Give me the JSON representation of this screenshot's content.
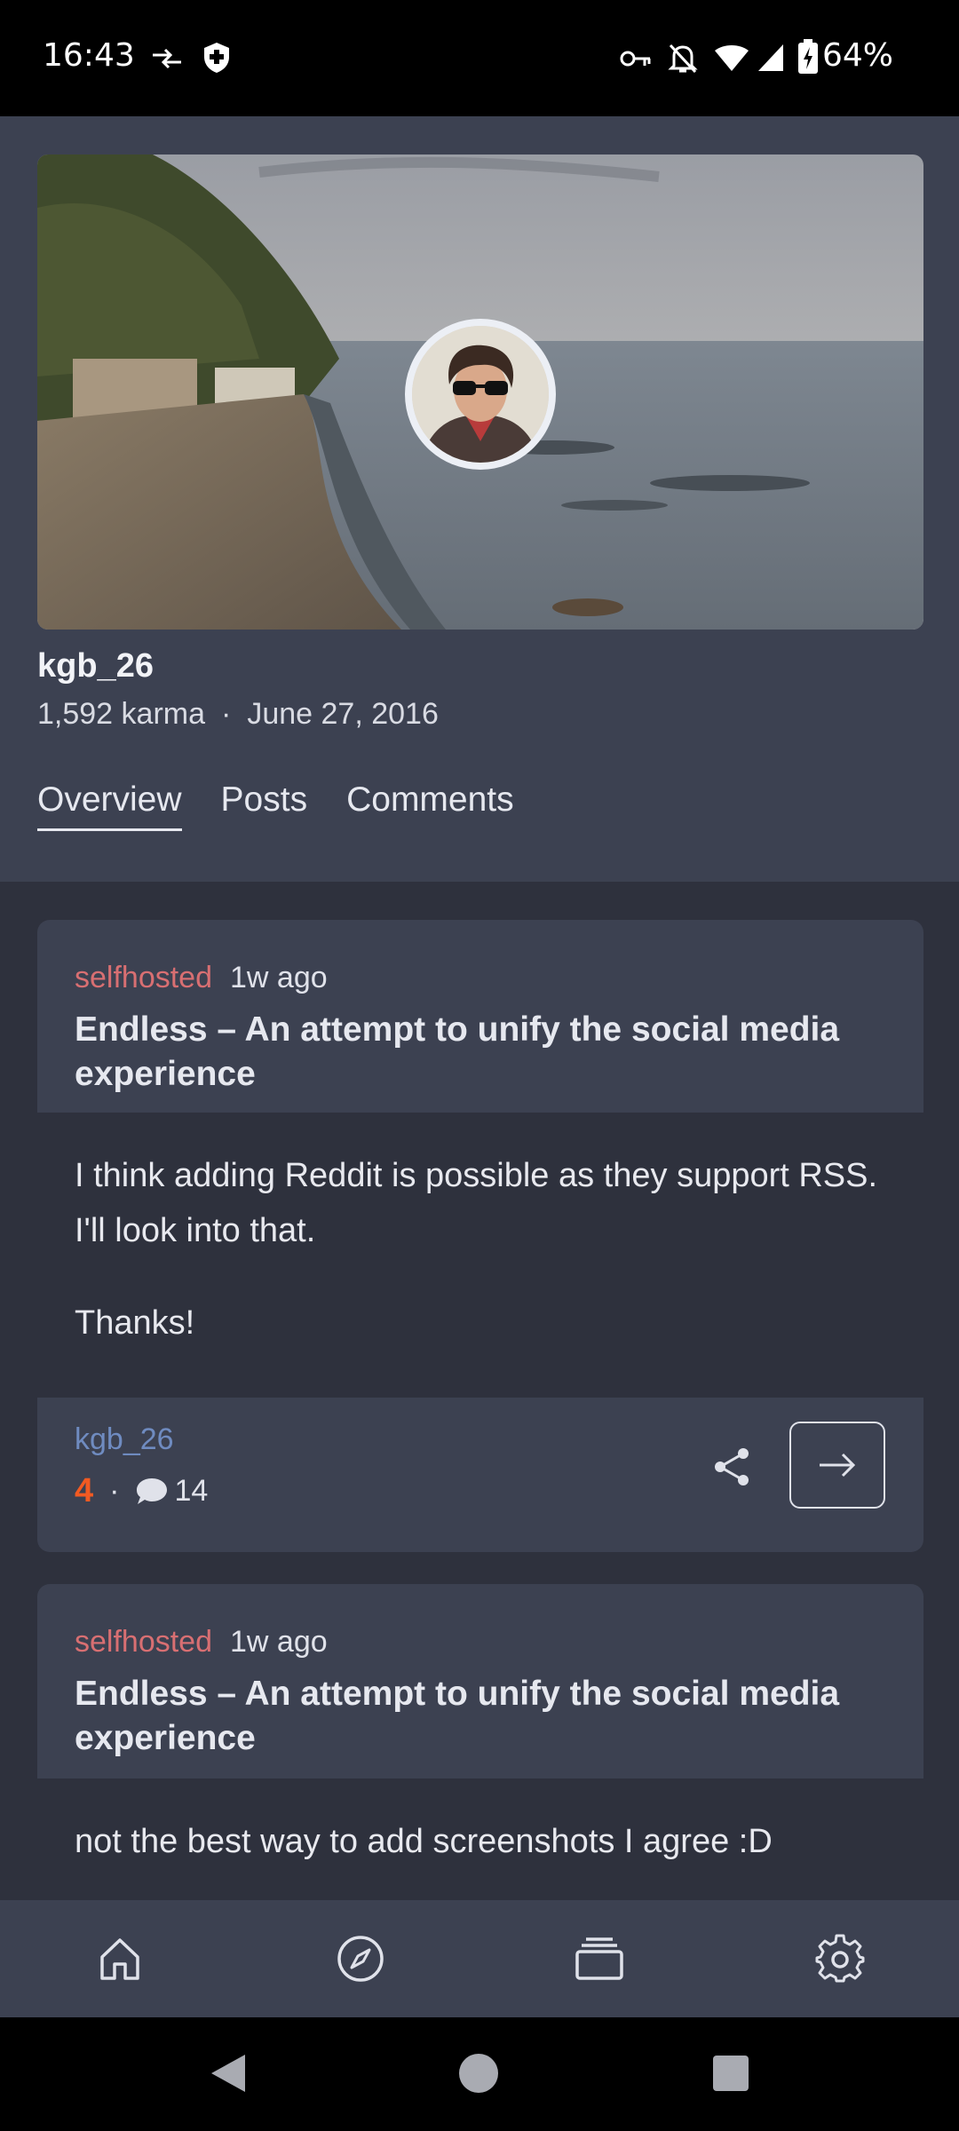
{
  "status_bar": {
    "time": "16:43",
    "battery": "64%",
    "icons": [
      "data-transfer-icon",
      "shield-icon",
      "vpn-key-icon",
      "bell-off-icon",
      "wifi-icon",
      "signal-icon",
      "battery-charging-icon"
    ]
  },
  "profile": {
    "username": "kgb_26",
    "karma": "1,592 karma",
    "separator": "·",
    "joined": "June 27, 2016",
    "tabs": [
      {
        "label": "Overview",
        "active": true
      },
      {
        "label": "Posts",
        "active": false
      },
      {
        "label": "Comments",
        "active": false
      }
    ]
  },
  "comments": [
    {
      "subreddit": "selfhosted",
      "age": "1w ago",
      "post_title": "Endless – An attempt to unify the social media experience",
      "body": [
        "I think adding Reddit is possible as they support RSS. I'll look into that.",
        "Thanks!"
      ],
      "author": "kgb_26",
      "score": "4",
      "separator": "·",
      "comment_count": "14"
    },
    {
      "subreddit": "selfhosted",
      "age": "1w ago",
      "post_title": "Endless – An attempt to unify the social media experience",
      "body": [
        "not the best way to add screenshots I agree :D"
      ]
    }
  ],
  "bottom_nav": [
    "home-icon",
    "compass-icon",
    "layers-icon",
    "settings-icon"
  ],
  "colors": {
    "background": "#2e313d",
    "surface": "#3c4151",
    "subreddit": "#d86f72",
    "author": "#6f8bc0",
    "score": "#f25a22"
  }
}
